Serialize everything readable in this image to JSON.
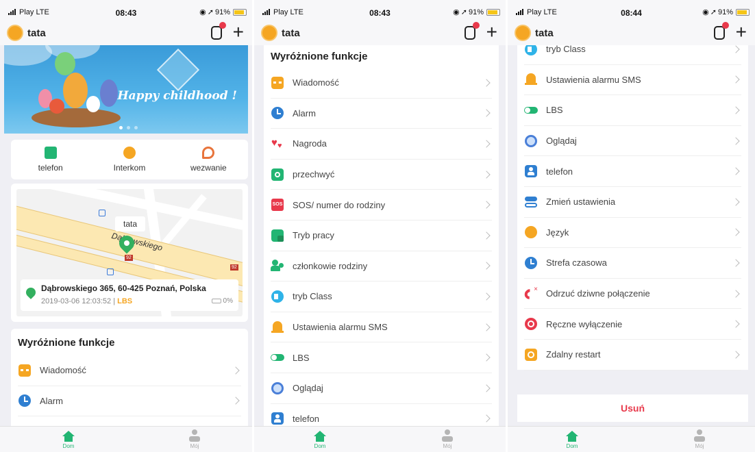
{
  "status": [
    {
      "carrier": "Play LTE",
      "time": "08:43",
      "battery": "91%"
    },
    {
      "carrier": "Play LTE",
      "time": "08:43",
      "battery": "91%"
    },
    {
      "carrier": "Play LTE",
      "time": "08:44",
      "battery": "91%"
    }
  ],
  "header": {
    "name": "tata",
    "add_label": "+"
  },
  "banner": {
    "text": "Happy childhood !"
  },
  "quick_actions": [
    {
      "label": "telefon",
      "icon": "phonebook-icon",
      "color": "#22b573"
    },
    {
      "label": "Interkom",
      "icon": "chat-bubble-icon",
      "color": "#f5a623"
    },
    {
      "label": "wezwanie",
      "icon": "call-icon",
      "color": "#e8743b"
    }
  ],
  "map": {
    "street_label": "Dąbrowskiego",
    "pin_label": "tata",
    "route_numbers": [
      "92",
      "92"
    ],
    "address": "Dąbrowskiego 365, 60-425 Poznań, Polska",
    "timestamp": "2019-03-06 12:03:52",
    "separator": "|",
    "source": "LBS",
    "battery": "0%"
  },
  "features_title": "Wyróżnione funkcje",
  "screen1_items": [
    {
      "label": "Wiadomość",
      "icon": "message-icon",
      "color": "#f5a623"
    },
    {
      "label": "Alarm",
      "icon": "alarm-clock-icon",
      "color": "#2f7fd1"
    }
  ],
  "screen2_items": [
    {
      "label": "Wiadomość",
      "icon": "message-icon",
      "color": "#f5a623"
    },
    {
      "label": "Alarm",
      "icon": "alarm-clock-icon",
      "color": "#2f7fd1"
    },
    {
      "label": "Nagroda",
      "icon": "hearts-icon",
      "color": "#e8394b"
    },
    {
      "label": "przechwyć",
      "icon": "camera-icon",
      "color": "#22b573"
    },
    {
      "label": "SOS/ numer do rodziny",
      "icon": "sos-icon",
      "color": "#e8394b"
    },
    {
      "label": "Tryb pracy",
      "icon": "work-mode-icon",
      "color": "#22b573"
    },
    {
      "label": "członkowie rodziny",
      "icon": "family-icon",
      "color": "#22b573"
    },
    {
      "label": "tryb Class",
      "icon": "speaker-icon",
      "color": "#2fb3e8"
    },
    {
      "label": "Ustawienia alarmu SMS",
      "icon": "bell-icon",
      "color": "#f5a623"
    },
    {
      "label": "LBS",
      "icon": "toggle-icon",
      "color": "#22b573"
    },
    {
      "label": "Oglądaj",
      "icon": "watch-face-icon",
      "color": "#4a7fd8"
    },
    {
      "label": "telefon",
      "icon": "contacts-icon",
      "color": "#2f7fd1"
    }
  ],
  "screen3_items": [
    {
      "label": "tryb Class",
      "icon": "speaker-icon",
      "color": "#2fb3e8"
    },
    {
      "label": "Ustawienia alarmu SMS",
      "icon": "bell-icon",
      "color": "#f5a623"
    },
    {
      "label": "LBS",
      "icon": "toggle-icon",
      "color": "#22b573"
    },
    {
      "label": "Oglądaj",
      "icon": "watch-face-icon",
      "color": "#4a7fd8"
    },
    {
      "label": "telefon",
      "icon": "contacts-icon",
      "color": "#2f7fd1"
    },
    {
      "label": "Zmień ustawienia",
      "icon": "settings-toggle-icon",
      "color": "#2f7fd1"
    },
    {
      "label": "Język",
      "icon": "globe-icon",
      "color": "#f5a623"
    },
    {
      "label": "Strefa czasowa",
      "icon": "clock-icon",
      "color": "#2f7fd1"
    },
    {
      "label": "Odrzuć dziwne połączenie",
      "icon": "reject-call-icon",
      "color": "#e8394b"
    },
    {
      "label": "Ręczne wyłączenie",
      "icon": "power-icon",
      "color": "#e8394b"
    },
    {
      "label": "Zdalny restart",
      "icon": "restart-watch-icon",
      "color": "#f5a623"
    }
  ],
  "delete_label": "Usuń",
  "tabs": {
    "home": "Dom",
    "me": "Mój"
  }
}
